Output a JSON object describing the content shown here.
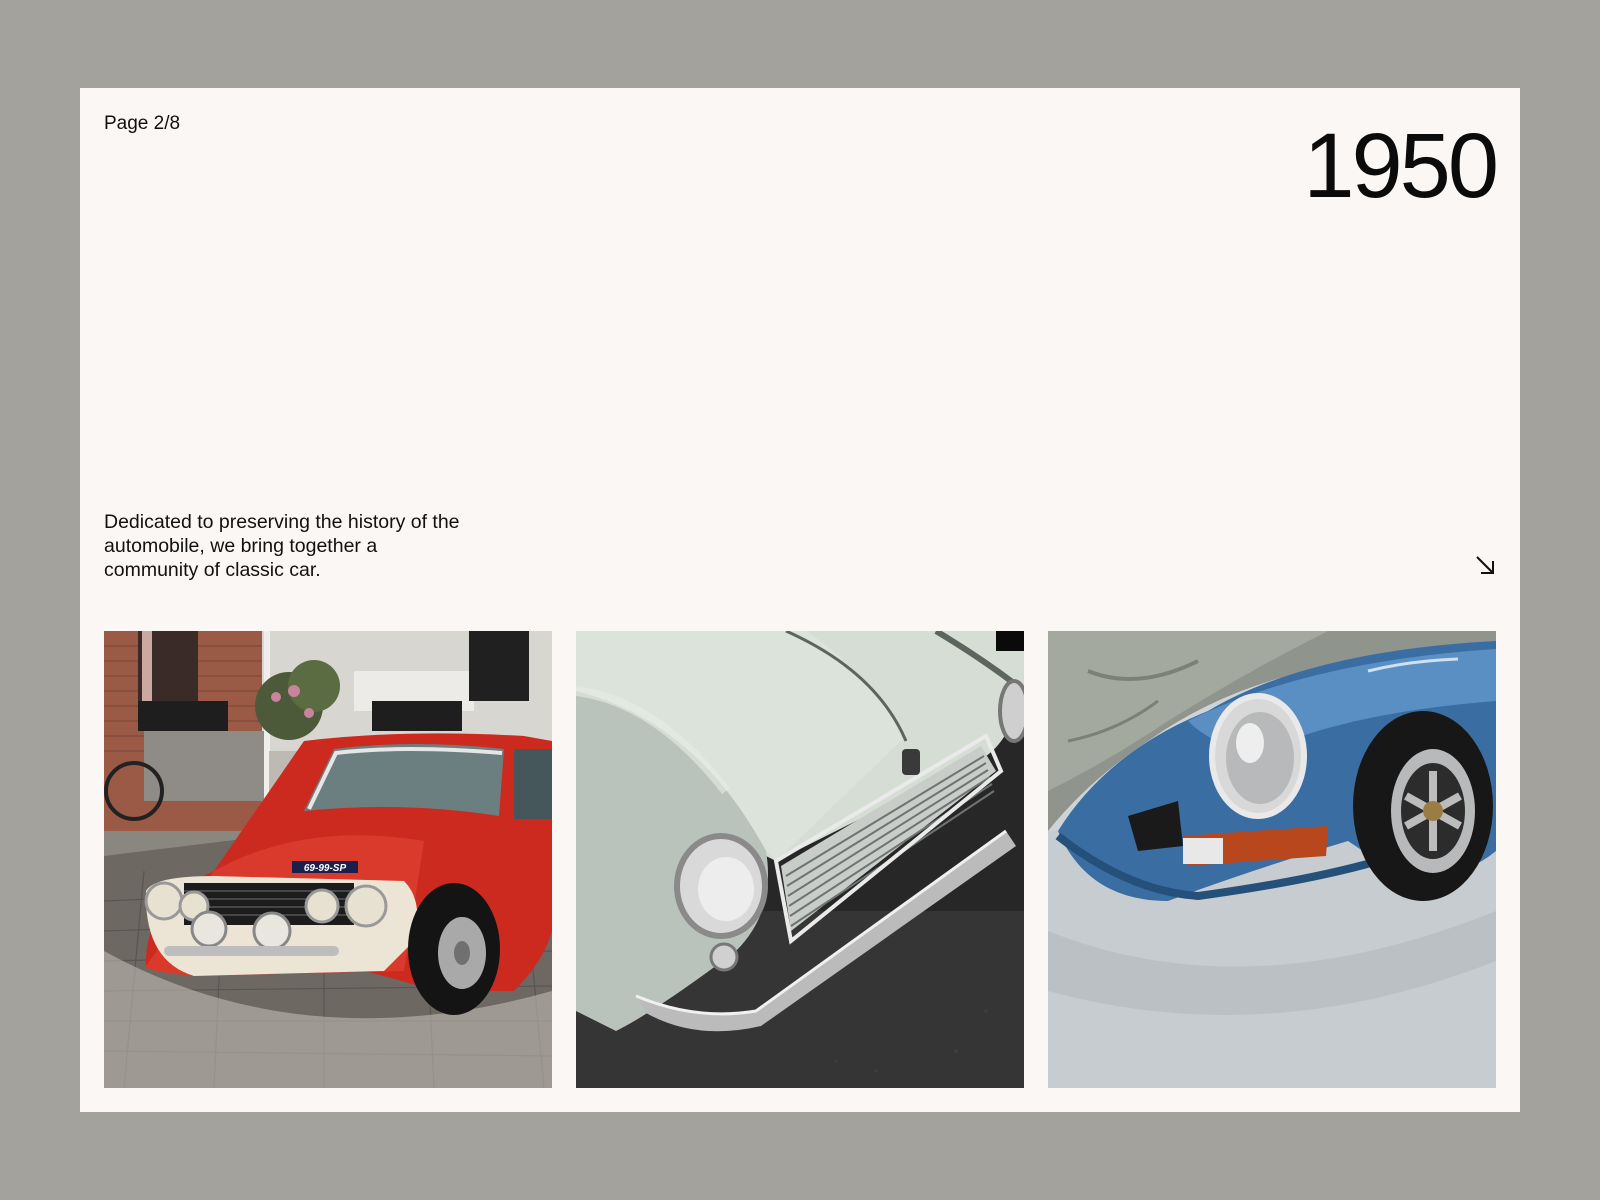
{
  "page": {
    "indicator": "Page 2/8",
    "year": "1950",
    "description": "Dedicated to preserving the history of the automobile, we bring together a community of classic car.",
    "next_icon": "arrow-down-right-icon"
  },
  "gallery": {
    "photos": [
      {
        "subject": "red classic coupe on cobblestone street",
        "plate": "69-99-SP"
      },
      {
        "subject": "pale green classic car front grille and headlight"
      },
      {
        "subject": "blue classic sports car headlight under cover"
      }
    ]
  },
  "colors": {
    "backdrop": "#a3a29d",
    "card": "#faf7f4",
    "text": "#111111"
  }
}
